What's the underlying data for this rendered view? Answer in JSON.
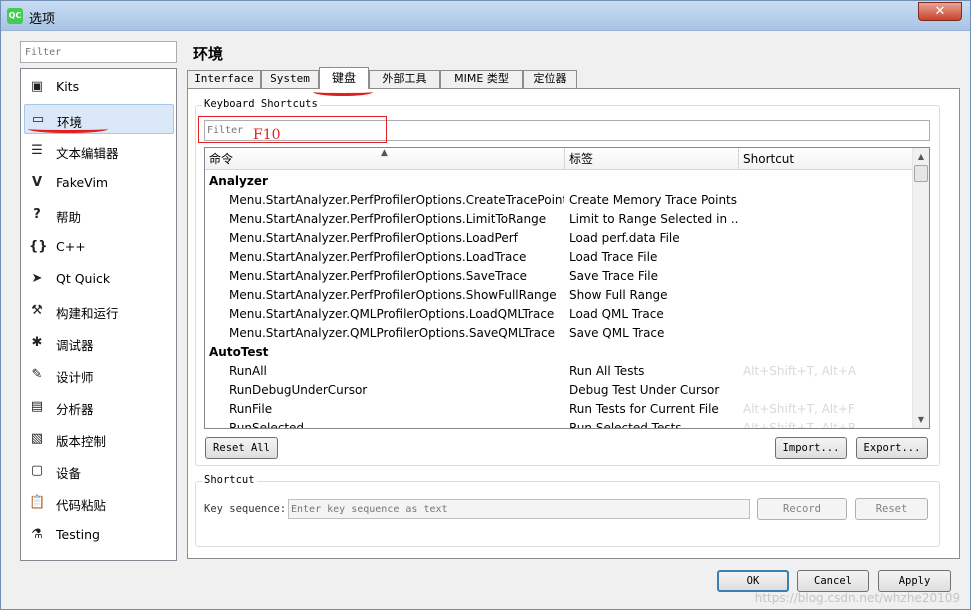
{
  "window": {
    "title": "选项",
    "app_icon_text": "QC",
    "close_glyph": "✕"
  },
  "sidebar": {
    "filter_placeholder": "Filter",
    "items": [
      {
        "label": "Kits",
        "icon": "kits-icon",
        "glyph": "▣"
      },
      {
        "label": "环境",
        "icon": "monitor-icon",
        "glyph": "▭",
        "selected": true
      },
      {
        "label": "文本编辑器",
        "icon": "text-editor-icon",
        "glyph": "☰"
      },
      {
        "label": "FakeVim",
        "icon": "fakevim-icon",
        "glyph": "V"
      },
      {
        "label": "帮助",
        "icon": "help-icon",
        "glyph": "?"
      },
      {
        "label": "C++",
        "icon": "cpp-braces-icon",
        "glyph": "{}"
      },
      {
        "label": "Qt Quick",
        "icon": "qt-quick-icon",
        "glyph": "➤"
      },
      {
        "label": "构建和运行",
        "icon": "hammer-icon",
        "glyph": "⚒"
      },
      {
        "label": "调试器",
        "icon": "bug-icon",
        "glyph": "✱"
      },
      {
        "label": "设计师",
        "icon": "pencil-icon",
        "glyph": "✎"
      },
      {
        "label": "分析器",
        "icon": "analyzer-icon",
        "glyph": "▤"
      },
      {
        "label": "版本控制",
        "icon": "version-control-icon",
        "glyph": "▧"
      },
      {
        "label": "设备",
        "icon": "device-icon",
        "glyph": "▢"
      },
      {
        "label": "代码粘贴",
        "icon": "clipboard-icon",
        "glyph": "📋"
      },
      {
        "label": "Testing",
        "icon": "testing-flask-icon",
        "glyph": "⚗"
      }
    ]
  },
  "main": {
    "title": "环境",
    "tabs": [
      {
        "label": "Interface"
      },
      {
        "label": "System"
      },
      {
        "label": "键盘",
        "active": true
      },
      {
        "label": "外部工具"
      },
      {
        "label": "MIME 类型"
      },
      {
        "label": "定位器"
      }
    ],
    "keyboard_group_title": "Keyboard Shortcuts",
    "filter_placeholder": "Filter",
    "annotation_text": "F10",
    "table": {
      "headers": [
        "命令",
        "标签",
        "Shortcut"
      ],
      "rows": [
        {
          "group": true,
          "command": "Analyzer",
          "label": "",
          "shortcut": ""
        },
        {
          "command": "Menu.StartAnalyzer.PerfProfilerOptions.CreateTracePoints",
          "label": "Create Memory Trace Points",
          "shortcut": ""
        },
        {
          "command": "Menu.StartAnalyzer.PerfProfilerOptions.LimitToRange",
          "label": "Limit to Range Selected in ...",
          "shortcut": ""
        },
        {
          "command": "Menu.StartAnalyzer.PerfProfilerOptions.LoadPerf",
          "label": "Load perf.data File",
          "shortcut": ""
        },
        {
          "command": "Menu.StartAnalyzer.PerfProfilerOptions.LoadTrace",
          "label": "Load Trace File",
          "shortcut": ""
        },
        {
          "command": "Menu.StartAnalyzer.PerfProfilerOptions.SaveTrace",
          "label": "Save Trace File",
          "shortcut": ""
        },
        {
          "command": "Menu.StartAnalyzer.PerfProfilerOptions.ShowFullRange",
          "label": "Show Full Range",
          "shortcut": ""
        },
        {
          "command": "Menu.StartAnalyzer.QMLProfilerOptions.LoadQMLTrace",
          "label": "Load QML Trace",
          "shortcut": ""
        },
        {
          "command": "Menu.StartAnalyzer.QMLProfilerOptions.SaveQMLTrace",
          "label": "Save QML Trace",
          "shortcut": ""
        },
        {
          "group": true,
          "command": "AutoTest",
          "label": "",
          "shortcut": ""
        },
        {
          "command": "RunAll",
          "label": "Run All Tests",
          "shortcut": "Alt+Shift+T, Alt+A"
        },
        {
          "command": "RunDebugUnderCursor",
          "label": "Debug Test Under Cursor",
          "shortcut": ""
        },
        {
          "command": "RunFile",
          "label": "Run Tests for Current File",
          "shortcut": "Alt+Shift+T, Alt+F"
        },
        {
          "command": "RunSelected",
          "label": "Run Selected Tests",
          "shortcut": "Alt+Shift+T, Alt+R"
        }
      ]
    },
    "buttons": {
      "reset_all": "Reset All",
      "import": "Import...",
      "export": "Export..."
    },
    "shortcut_group_title": "Shortcut",
    "key_sequence_label": "Key sequence:",
    "key_sequence_placeholder": "Enter key sequence as text",
    "record": "Record",
    "reset": "Reset"
  },
  "footer": {
    "ok": "OK",
    "cancel": "Cancel",
    "apply": "Apply"
  },
  "watermark": "https://blog.csdn.net/whzhe20109"
}
